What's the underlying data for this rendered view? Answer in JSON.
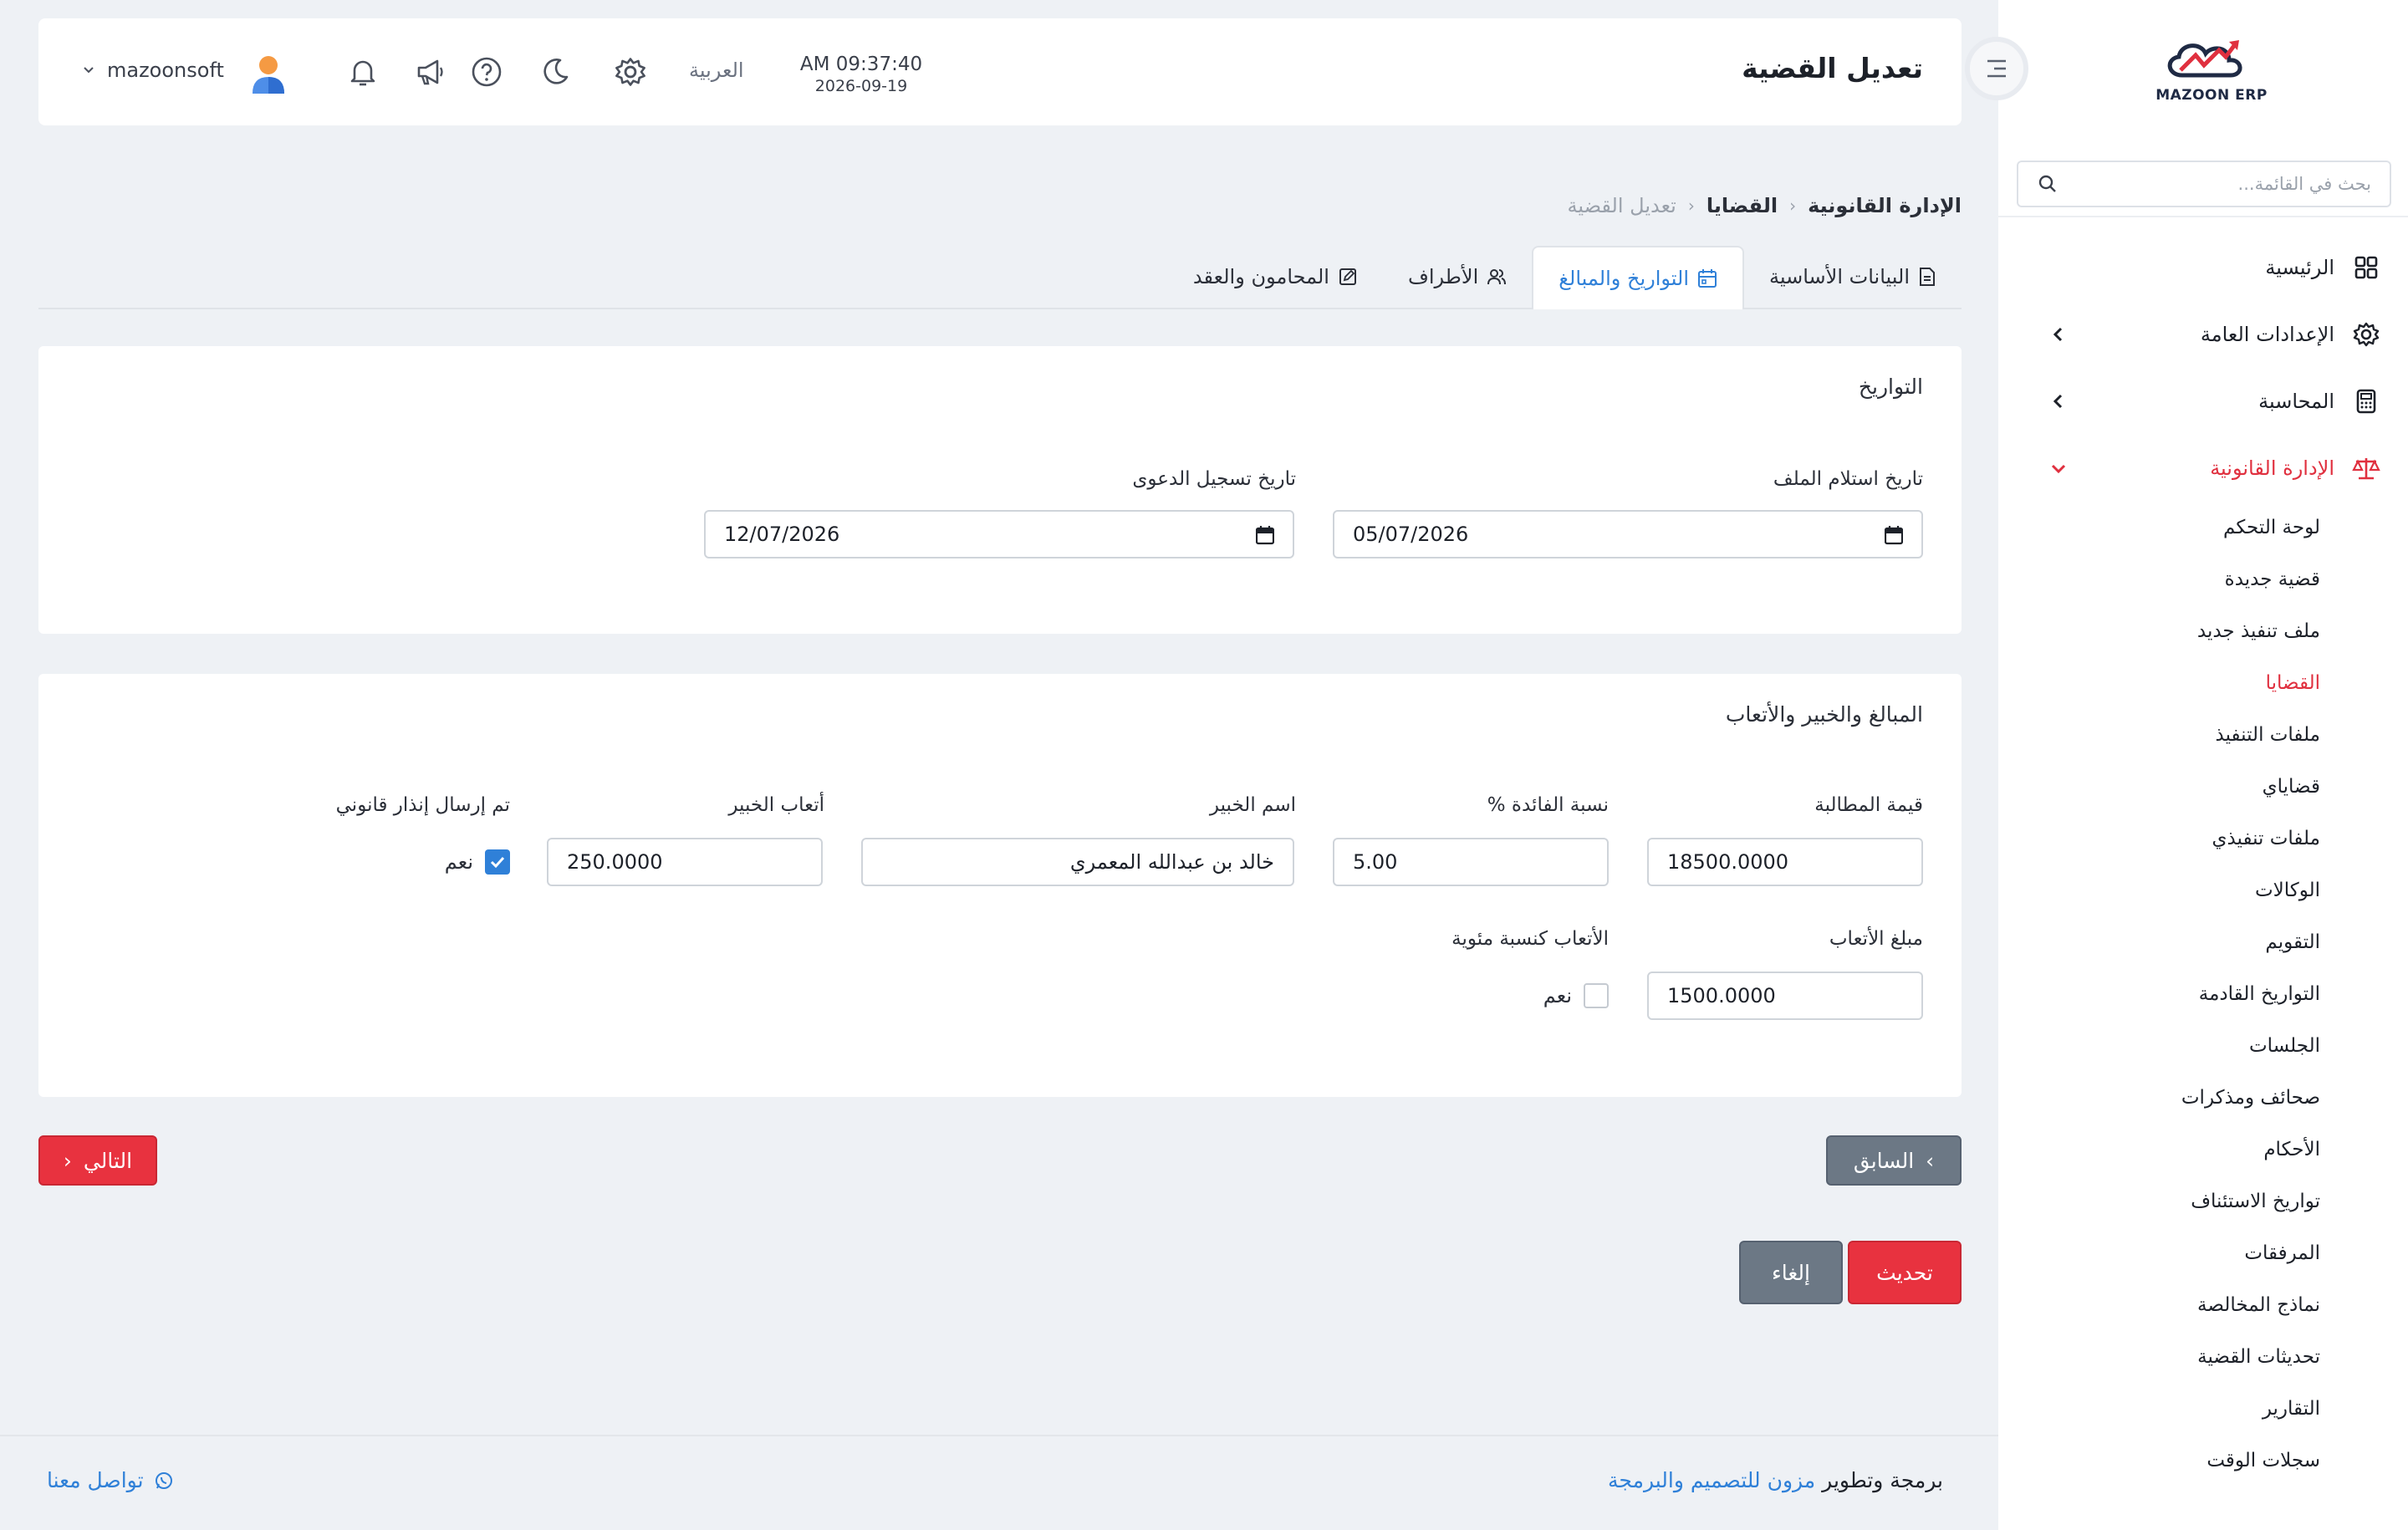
{
  "header": {
    "page_title": "تعديل القضية",
    "time": "AM 09:37:40",
    "date": "2026-09-19",
    "language": "العربية",
    "username": "mazoonsoft"
  },
  "sidebar": {
    "logo_text": "MAZOON ERP",
    "search_placeholder": "بحث في القائمة...",
    "items": [
      {
        "label": "الرئيسية",
        "icon": "grid-icon"
      },
      {
        "label": "الإعدادات العامة",
        "icon": "gear-icon"
      },
      {
        "label": "المحاسبة",
        "icon": "calculator-icon"
      },
      {
        "label": "الإدارة القانونية",
        "icon": "scales-icon"
      }
    ],
    "submenu": [
      "لوحة التحكم",
      "قضية جديدة",
      "ملف تنفيذ جديد",
      "القضايا",
      "ملفات التنفيذ",
      "قضاياي",
      "ملفات تنفيذي",
      "الوكالات",
      "التقويم",
      "التواريخ القادمة",
      "الجلسات",
      "صحائف ومذكرات",
      "الأحكام",
      "تواريخ الاستئناف",
      "المرفقات",
      "نماذج المخالصة",
      "تحديثات القضية",
      "التقارير",
      "سجلات الوقت"
    ],
    "active_submenu": "القضايا"
  },
  "breadcrumb": [
    "الإدارة القانونية",
    "القضايا",
    "تعديل القضية"
  ],
  "tabs": [
    {
      "label": "البيانات الأساسية",
      "icon": "document-icon"
    },
    {
      "label": "التواريخ والمبالغ",
      "icon": "calendar-icon",
      "active": true
    },
    {
      "label": "الأطراف",
      "icon": "users-icon"
    },
    {
      "label": "المحامون والعقد",
      "icon": "edit-icon"
    }
  ],
  "dates_card": {
    "title": "التواريخ",
    "file_received_label": "تاريخ استلام الملف",
    "file_received_value": "05/07/2026",
    "filing_date_label": "تاريخ تسجيل الدعوى",
    "filing_date_value": "12/07/2026"
  },
  "amounts_card": {
    "title": "المبالغ والخبير والأتعاب",
    "claim_label": "قيمة المطالبة",
    "claim_value": "18500.0000",
    "interest_label": "نسبة الفائدة %",
    "interest_value": "5.00",
    "expert_name_label": "اسم الخبير",
    "expert_name_value": "خالد بن عبدالله المعمري",
    "expert_fees_label": "أتعاب الخبير",
    "expert_fees_value": "250.0000",
    "notice_label": "تم إرسال إنذار قانوني",
    "notice_checked": true,
    "fees_amount_label": "مبلغ الأتعاب",
    "fees_amount_value": "1500.0000",
    "fees_percent_label": "الأتعاب كنسبة مئوية",
    "fees_percent_checked": false,
    "yes_label": "نعم"
  },
  "buttons": {
    "next": "التالي",
    "previous": "السابق",
    "update": "تحديث",
    "cancel": "إلغاء"
  },
  "footer": {
    "prefix": "برمجة وتطوير",
    "company": "مزون للتصميم والبرمجة",
    "contact": "تواصل معنا"
  },
  "colors": {
    "accent_red": "#e8323f",
    "accent_blue": "#2f80d8",
    "gray_button": "#6c7885"
  }
}
